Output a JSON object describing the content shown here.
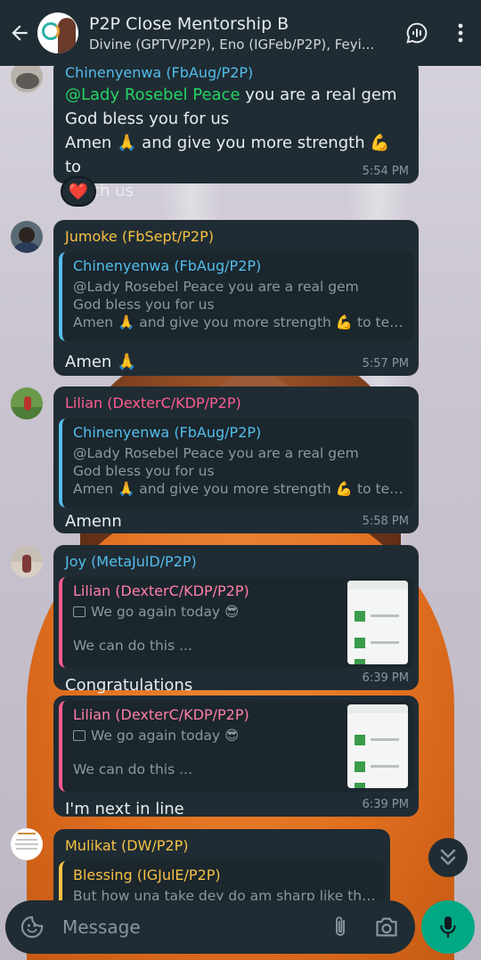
{
  "header": {
    "title": "P2P Close Mentorship B",
    "members": "Divine (GPTV/P2P), Eno (IGFeb/P2P), Feyi..."
  },
  "messages": [
    {
      "sender": "Chinenyenwa (FbAug/P2P)",
      "sender_color": "#53bdeb",
      "mention": "@Lady Rosebel Peace",
      "line1_rest": " you are a real gem",
      "line2": "God bless you for us",
      "line3_a": "Amen 🙏 and give you more strength 💪 to",
      "line4": "teach us",
      "time": "5:54 PM",
      "reaction": "❤️"
    },
    {
      "sender": "Jumoke (FbSept/P2P)",
      "sender_color": "#f7c242",
      "quote_sender": "Chinenyenwa (FbAug/P2P)",
      "quote_line1": "@Lady Rosebel Peace you are a real gem",
      "quote_line2": "God bless you for us",
      "quote_line3": "Amen 🙏 and give you more strength 💪 to teach...",
      "text": "Amen 🙏",
      "time": "5:57 PM"
    },
    {
      "sender": "Lilian (DexterC/KDP/P2P)",
      "sender_color": "#ff5c8f",
      "quote_sender": "Chinenyenwa (FbAug/P2P)",
      "quote_line1": "@Lady Rosebel Peace you are a real gem",
      "quote_line2": "God bless you for us",
      "quote_line3": "Amen 🙏 and give you more strength 💪 to teach...",
      "text": "Amenn",
      "time": "5:58 PM"
    },
    {
      "sender": "Joy (MetaJulD/P2P)",
      "sender_color": "#53bdeb",
      "quote_sender": "Lilian (DexterC/KDP/P2P)",
      "quote_line1": "We go again today 😎",
      "quote_line3": "We can do this ...",
      "text": "Congratulations",
      "time": "6:39 PM"
    },
    {
      "quote_sender": "Lilian (DexterC/KDP/P2P)",
      "quote_line1": "We go again today 😎",
      "quote_line3": "We can do this ...",
      "text": "I'm next in line",
      "time": "6:39 PM"
    },
    {
      "sender": "Mulikat (DW/P2P)",
      "sender_color": "#f7c242",
      "quote_sender": "Blessing (IGJulE/P2P)",
      "quote_line1": "But how una take dey do am sharp like this?!"
    }
  ],
  "input": {
    "placeholder": "Message"
  },
  "icons": {
    "back": "back-arrow-icon",
    "voice_call": "voice-chat-icon",
    "menu": "more-vert-icon",
    "emoji": "sticker-icon",
    "attach": "paperclip-icon",
    "camera": "camera-icon",
    "mic": "mic-icon",
    "scroll": "double-chevron-down-icon"
  },
  "colors": {
    "header_bg": "#1f2c34",
    "bubble_bg": "#1f2c34",
    "mic_green": "#00a884",
    "mention_blue": "#53bdeb"
  }
}
